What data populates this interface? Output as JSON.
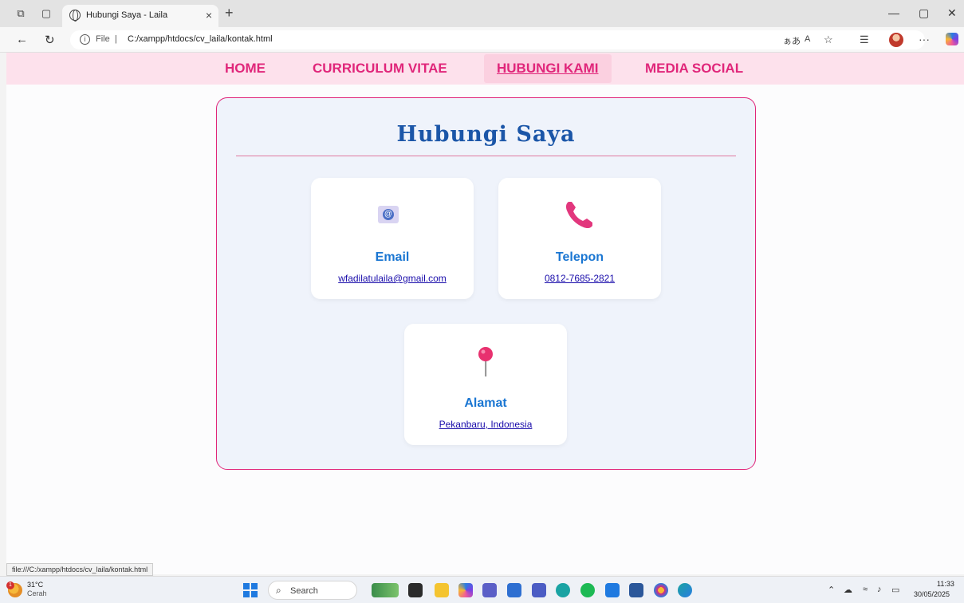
{
  "browser": {
    "tab_title": "Hubungi Saya - Laila",
    "tab_close": "×",
    "new_tab": "+",
    "url_scheme_label": "File",
    "url_separator": "|",
    "url": "C:/xampp/htdocs/cv_laila/kontak.html",
    "status_url": "file:///C:/xampp/htdocs/cv_laila/kontak.html"
  },
  "nav": {
    "items": [
      {
        "label": "HOME"
      },
      {
        "label": "CURRICULUM VITAE"
      },
      {
        "label": "HUBUNGI KAMI",
        "active": true
      },
      {
        "label": "MEDIA SOCIAL"
      }
    ]
  },
  "contact": {
    "heading": "Hubungi Saya",
    "cards": [
      {
        "label": "Email",
        "value": "wfadilatulaila@gmail.com",
        "icon": "email-icon"
      },
      {
        "label": "Telepon",
        "value": "0812-7685-2821",
        "icon": "phone-icon"
      },
      {
        "label": "Alamat",
        "value": "Pekanbaru, Indonesia",
        "icon": "pin-icon"
      }
    ]
  },
  "taskbar": {
    "weather_temp": "31°C",
    "weather_desc": "Cerah",
    "weather_badge": "1",
    "search_label": "Search",
    "time": "11:33",
    "date": "30/05/2025"
  },
  "colors": {
    "accent_pink": "#e0267a",
    "heading_blue": "#1b56a8",
    "label_blue": "#1a76d2",
    "nav_bg": "#fde1ec"
  }
}
